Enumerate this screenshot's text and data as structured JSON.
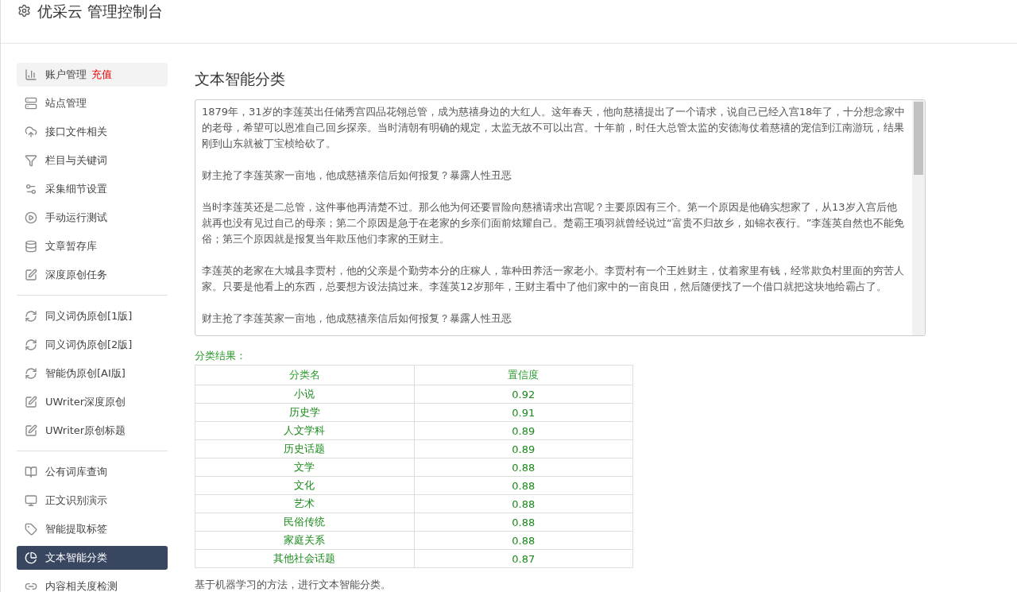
{
  "header": {
    "title": "优采云 管理控制台"
  },
  "sidebar": {
    "groups": [
      {
        "items": [
          {
            "label": "账户管理",
            "badge": "充值",
            "selected": false,
            "hover": true
          },
          {
            "label": "站点管理",
            "selected": false
          },
          {
            "label": "接口文件相关",
            "selected": false
          },
          {
            "label": "栏目与关键词",
            "selected": false
          },
          {
            "label": "采集细节设置",
            "selected": false
          },
          {
            "label": "手动运行测试",
            "selected": false
          },
          {
            "label": "文章暂存库",
            "selected": false
          },
          {
            "label": "深度原创任务",
            "selected": false
          }
        ]
      },
      {
        "items": [
          {
            "label": "同义词伪原创[1版]",
            "selected": false
          },
          {
            "label": "同义词伪原创[2版]",
            "selected": false
          },
          {
            "label": "智能伪原创[AI版]",
            "selected": false
          },
          {
            "label": "UWriter深度原创",
            "selected": false
          },
          {
            "label": "UWriter原创标题",
            "selected": false
          }
        ]
      },
      {
        "items": [
          {
            "label": "公有词库查询",
            "selected": false
          },
          {
            "label": "正文识别演示",
            "selected": false
          },
          {
            "label": "智能提取标签",
            "selected": false
          },
          {
            "label": "文本智能分类",
            "selected": true
          },
          {
            "label": "内容相关度检测",
            "selected": false
          }
        ]
      }
    ]
  },
  "main": {
    "title": "文本智能分类",
    "text_area": {
      "paragraphs": [
        "1879年，31岁的李莲英出任储秀宫四品花翎总管，成为慈禧身边的大红人。这年春天，他向慈禧提出了一个请求，说自己已经入宫18年了，十分想念家中的老母，希望可以恩准自己回乡探亲。当时清朝有明确的规定，太监无故不可以出宫。十年前，时任大总管太监的安德海仗着慈禧的宠信到江南游玩，结果刚到山东就被丁宝桢给砍了。",
        "财主抢了李莲英家一亩地，他成慈禧亲信后如何报复？暴露人性丑恶",
        "当时李莲英还是二总管，这件事他再清楚不过。那么他为何还要冒险向慈禧请求出宫呢？主要原因有三个。第一个原因是他确实想家了，从13岁入宫后他就再也没有见过自己的母亲；第二个原因是急于在老家的乡亲们面前炫耀自己。楚霸王项羽就曾经说过“富贵不归故乡，如锦衣夜行。”李莲英自然也不能免俗；第三个原因就是报复当年欺压他们李家的王财主。",
        "李莲英的老家在大城县李贾村，他的父亲是个勤劳本分的庄稼人，靠种田养活一家老小。李贾村有一个王姓财主，仗着家里有钱，经常欺负村里面的穷苦人家。只要是他看上的东西，总要想方设法搞过来。李莲英12岁那年，王财主看中了他们家中的一亩良田，然后随便找了一个借口就把这块地给霸占了。",
        "财主抢了李莲英家一亩地，他成慈禧亲信后如何报复？暴露人性丑恶"
      ]
    },
    "result_label": "分类结果：",
    "table": {
      "columns": [
        "分类名",
        "置信度"
      ],
      "rows": [
        [
          "小说",
          "0.92"
        ],
        [
          "历史学",
          "0.91"
        ],
        [
          "人文学科",
          "0.89"
        ],
        [
          "历史话题",
          "0.89"
        ],
        [
          "文学",
          "0.88"
        ],
        [
          "文化",
          "0.88"
        ],
        [
          "艺术",
          "0.88"
        ],
        [
          "民俗传统",
          "0.88"
        ],
        [
          "家庭关系",
          "0.88"
        ],
        [
          "其他社会话题",
          "0.87"
        ]
      ]
    },
    "note": "基于机器学习的方法，进行文本智能分类。"
  }
}
